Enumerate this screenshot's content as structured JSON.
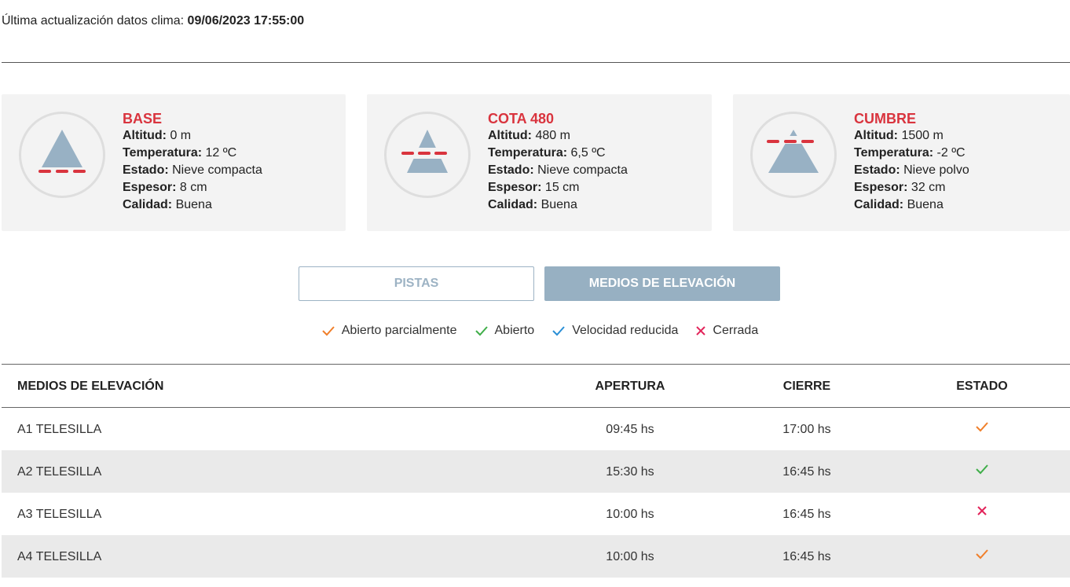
{
  "update": {
    "label": "Última actualización datos clima:",
    "value": "09/06/2023 17:55:00"
  },
  "stations": [
    {
      "name": "BASE",
      "altitud_label": "Altitud:",
      "altitud": "0 m",
      "temp_label": "Temperatura:",
      "temp": "12 ºC",
      "estado_label": "Estado:",
      "estado": "Nieve compacta",
      "espesor_label": "Espesor:",
      "espesor": "8 cm",
      "calidad_label": "Calidad:",
      "calidad": "Buena",
      "icon": "mountain-base-icon"
    },
    {
      "name": "COTA 480",
      "altitud_label": "Altitud:",
      "altitud": "480 m",
      "temp_label": "Temperatura:",
      "temp": "6,5 ºC",
      "estado_label": "Estado:",
      "estado": "Nieve compacta",
      "espesor_label": "Espesor:",
      "espesor": "15 cm",
      "calidad_label": "Calidad:",
      "calidad": "Buena",
      "icon": "mountain-mid-icon"
    },
    {
      "name": "CUMBRE",
      "altitud_label": "Altitud:",
      "altitud": "1500 m",
      "temp_label": "Temperatura:",
      "temp": "-2 ºC",
      "estado_label": "Estado:",
      "estado": "Nieve polvo",
      "espesor_label": "Espesor:",
      "espesor": "32 cm",
      "calidad_label": "Calidad:",
      "calidad": "Buena",
      "icon": "mountain-summit-icon"
    }
  ],
  "tabs": {
    "pistas": "PISTAS",
    "medios": "MEDIOS DE ELEVACIÓN",
    "active": "medios"
  },
  "legend": [
    {
      "label": "Abierto parcialmente",
      "icon": "check-icon",
      "color": "#f07f2a"
    },
    {
      "label": "Abierto",
      "icon": "check-icon",
      "color": "#3fae49"
    },
    {
      "label": "Velocidad reducida",
      "icon": "check-icon",
      "color": "#2a8fd6"
    },
    {
      "label": "Cerrada",
      "icon": "cross-icon",
      "color": "#e2245a"
    }
  ],
  "table": {
    "headers": {
      "name": "MEDIOS DE ELEVACIÓN",
      "open": "APERTURA",
      "close": "CIERRE",
      "state": "ESTADO"
    },
    "rows": [
      {
        "name": "A1 TELESILLA",
        "open": "09:45 hs",
        "close": "17:00 hs",
        "state": "Abierto parcialmente"
      },
      {
        "name": "A2 TELESILLA",
        "open": "15:30 hs",
        "close": "16:45 hs",
        "state": "Abierto"
      },
      {
        "name": "A3 TELESILLA",
        "open": "10:00 hs",
        "close": "16:45 hs",
        "state": "Cerrada"
      },
      {
        "name": "A4 TELESILLA",
        "open": "10:00 hs",
        "close": "16:45 hs",
        "state": "Abierto parcialmente"
      }
    ]
  },
  "colors": {
    "accent_red": "#d9343e",
    "mountain": "#98b1c4",
    "button_active": "#97b0c2"
  }
}
